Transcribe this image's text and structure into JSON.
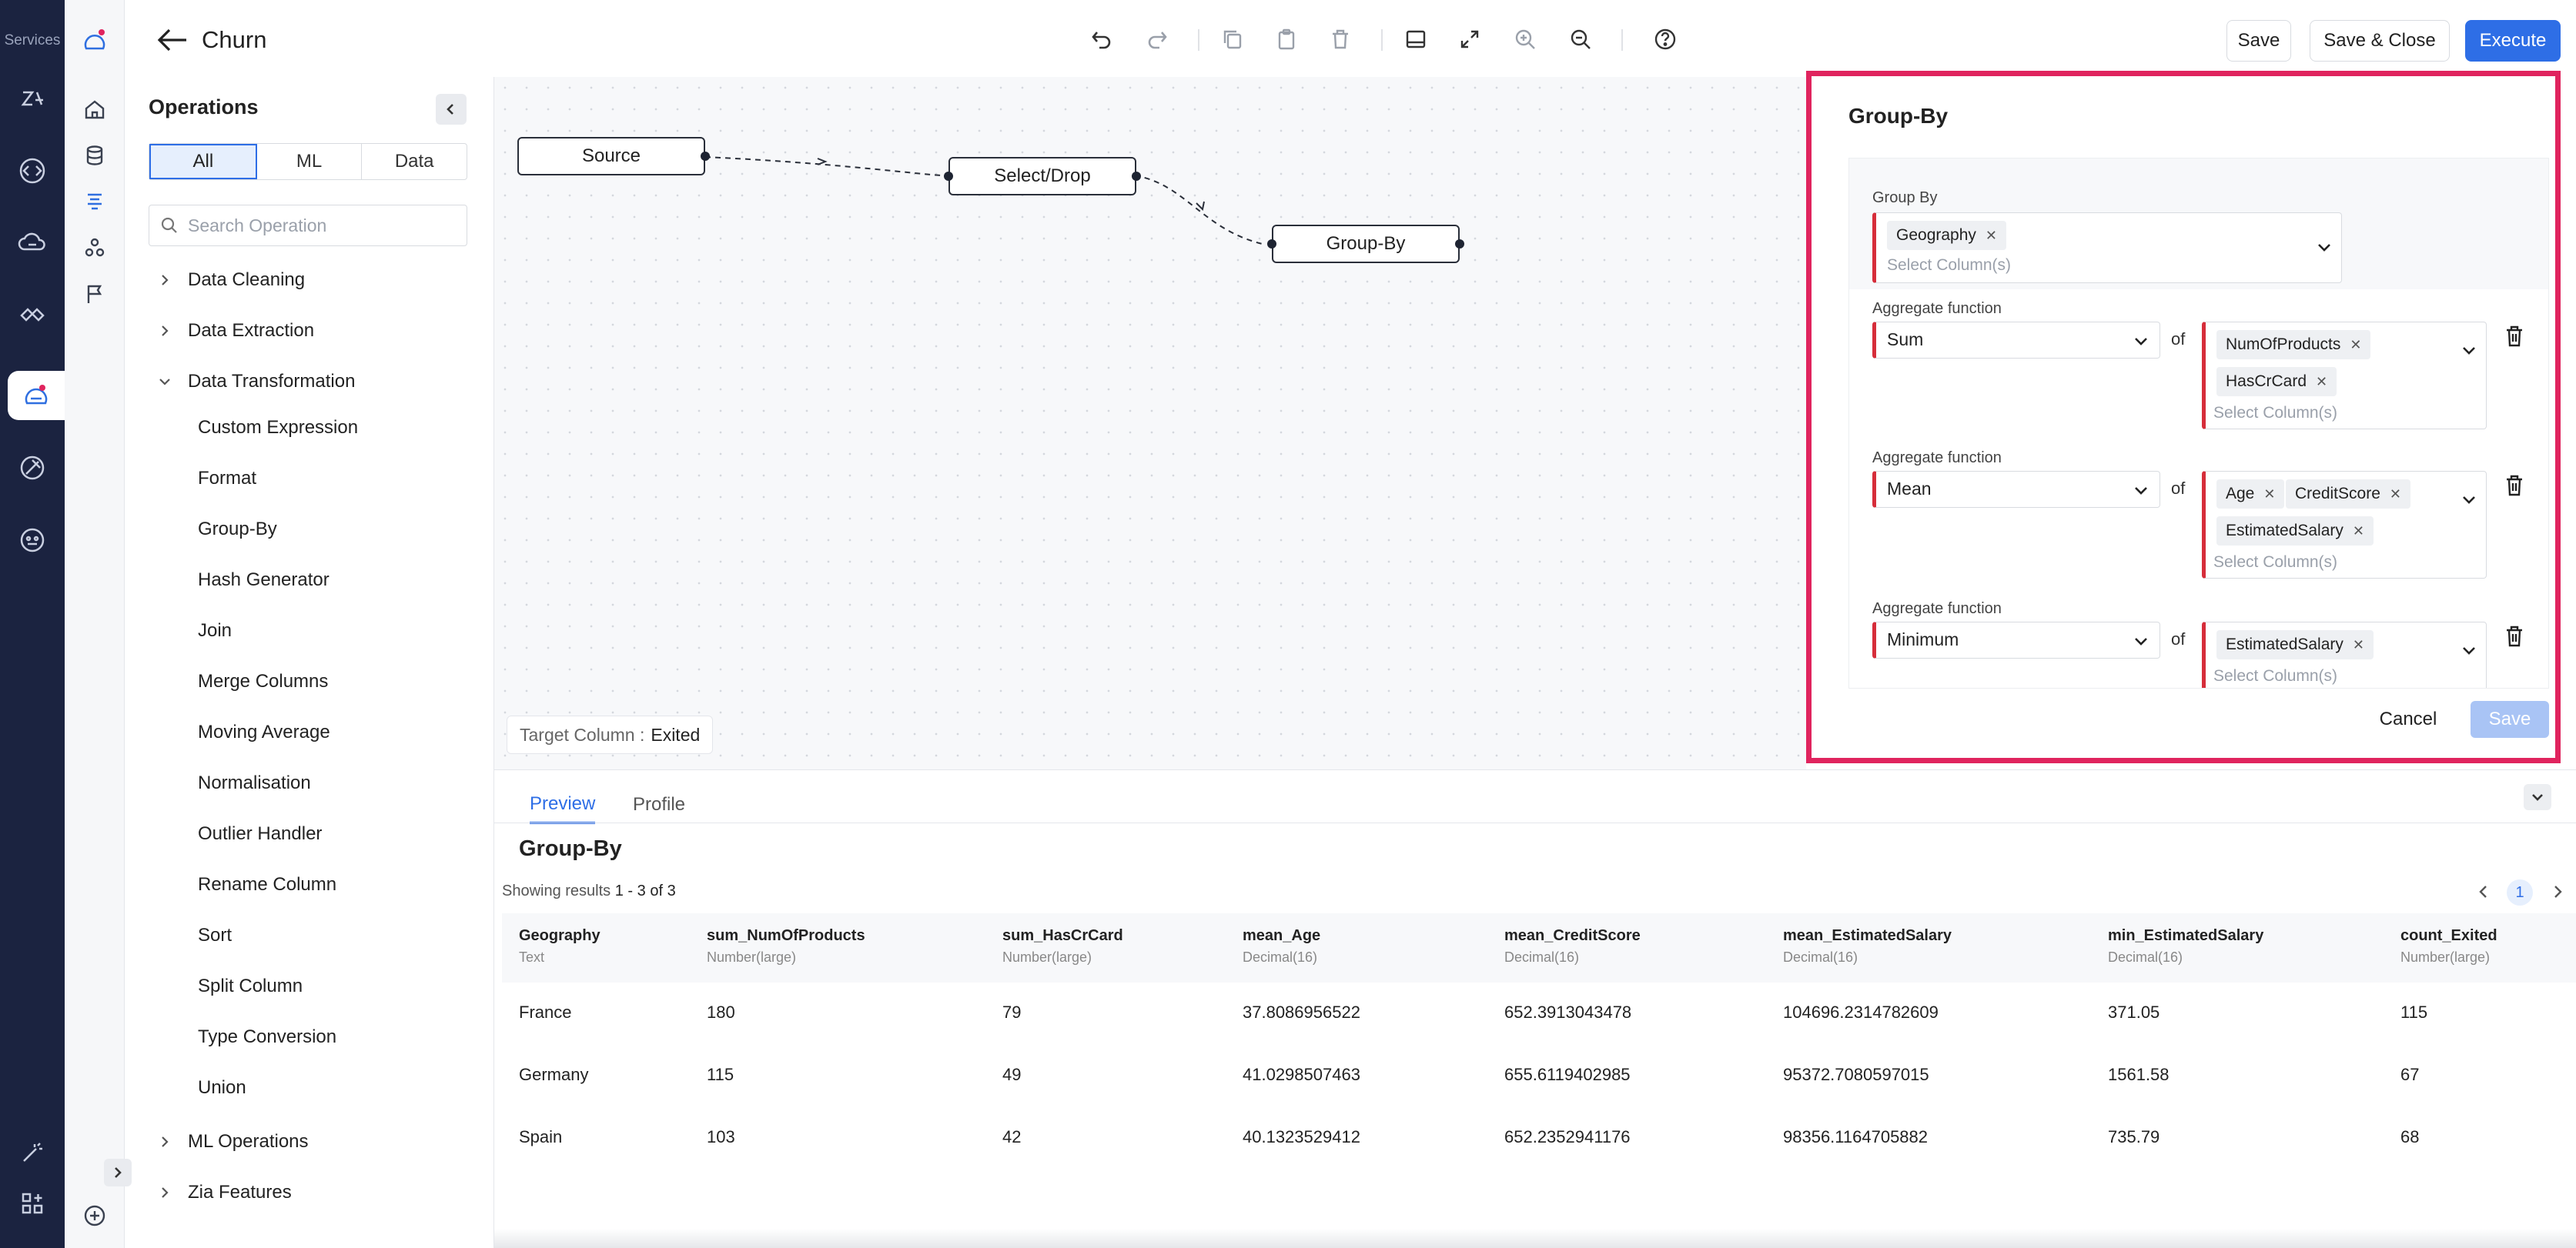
{
  "rail": {
    "label": "Services",
    "items": [
      {
        "icon": "zia-icon"
      },
      {
        "icon": "code-icon"
      },
      {
        "icon": "cloud-icon"
      },
      {
        "icon": "integration-icon"
      },
      {
        "icon": "dataprep-icon"
      },
      {
        "icon": "satellite-icon"
      },
      {
        "icon": "bot-icon"
      }
    ],
    "bottom": [
      {
        "icon": "magic-wand-icon"
      },
      {
        "icon": "grid-plus-icon"
      }
    ]
  },
  "header": {
    "title": "Churn",
    "save_label": "Save",
    "save_close_label": "Save & Close",
    "execute_label": "Execute"
  },
  "operations": {
    "title": "Operations",
    "filters": [
      "All",
      "ML",
      "Data"
    ],
    "active_filter": "All",
    "search_placeholder": "Search Operation",
    "categories": {
      "data_cleaning": "Data Cleaning",
      "data_extraction": "Data Extraction",
      "data_transformation": "Data Transformation",
      "ml_operations": "ML Operations",
      "zia_features": "Zia Features"
    },
    "transformation_items": [
      "Custom Expression",
      "Format",
      "Group-By",
      "Hash Generator",
      "Join",
      "Merge Columns",
      "Moving Average",
      "Normalisation",
      "Outlier Handler",
      "Rename Column",
      "Sort",
      "Split Column",
      "Type Conversion",
      "Union"
    ]
  },
  "canvas": {
    "nodes": {
      "source": "Source",
      "select_drop": "Select/Drop",
      "group_by": "Group-By"
    },
    "target_label": "Target Column :",
    "target_value": "Exited"
  },
  "group_by_panel": {
    "title": "Group-By",
    "group_by_label": "Group By",
    "group_by_chips": [
      "Geography"
    ],
    "placeholder": "Select Column(s)",
    "aggregate_label": "Aggregate function",
    "of_label": "of",
    "aggregates": [
      {
        "function": "Sum",
        "columns": [
          "NumOfProducts",
          "HasCrCard"
        ]
      },
      {
        "function": "Mean",
        "columns": [
          "Age",
          "CreditScore",
          "EstimatedSalary"
        ]
      },
      {
        "function": "Minimum",
        "columns": [
          "EstimatedSalary"
        ]
      }
    ],
    "cancel_label": "Cancel",
    "save_label": "Save"
  },
  "preview": {
    "tabs": [
      "Preview",
      "Profile"
    ],
    "active_tab": "Preview",
    "title": "Group-By",
    "showing_prefix": "Showing results",
    "showing_range": "1 - 3 of 3",
    "page": "1",
    "columns": [
      {
        "name": "Geography",
        "type": "Text"
      },
      {
        "name": "sum_NumOfProducts",
        "type": "Number(large)"
      },
      {
        "name": "sum_HasCrCard",
        "type": "Number(large)"
      },
      {
        "name": "mean_Age",
        "type": "Decimal(16)"
      },
      {
        "name": "mean_CreditScore",
        "type": "Decimal(16)"
      },
      {
        "name": "mean_EstimatedSalary",
        "type": "Decimal(16)"
      },
      {
        "name": "min_EstimatedSalary",
        "type": "Decimal(16)"
      },
      {
        "name": "count_Exited",
        "type": "Number(large)"
      }
    ],
    "rows": [
      [
        "France",
        "180",
        "79",
        "37.8086956522",
        "652.3913043478",
        "104696.2314782609",
        "371.05",
        "115"
      ],
      [
        "Germany",
        "115",
        "49",
        "41.0298507463",
        "655.6119402985",
        "95372.7080597015",
        "1561.58",
        "67"
      ],
      [
        "Spain",
        "103",
        "42",
        "40.1323529412",
        "652.2352941176",
        "98356.1164705882",
        "735.79",
        "68"
      ]
    ]
  },
  "colors": {
    "rail": "#1b2340",
    "accent": "#2e6ee6",
    "highlight_border": "#e0245e",
    "required_marker": "#d62d3a"
  }
}
